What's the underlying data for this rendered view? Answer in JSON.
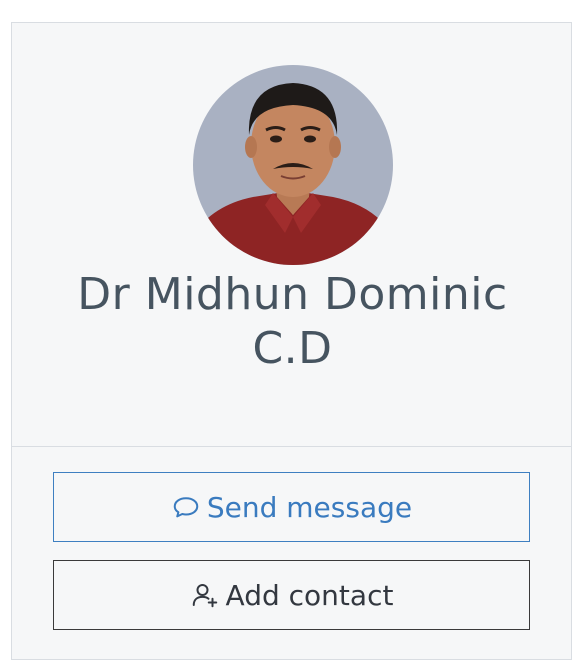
{
  "profile": {
    "name": "Dr Midhun Dominic C.D",
    "avatar_alt": "profile-photo"
  },
  "actions": {
    "send_message_label": "Send message",
    "send_message_icon": "chat-bubble-icon",
    "add_contact_label": "Add contact",
    "add_contact_icon": "user-add-icon"
  },
  "colors": {
    "accent": "#3a7bbf",
    "text": "#465460",
    "card_bg": "#f6f7f8",
    "border": "#d9dde2"
  }
}
